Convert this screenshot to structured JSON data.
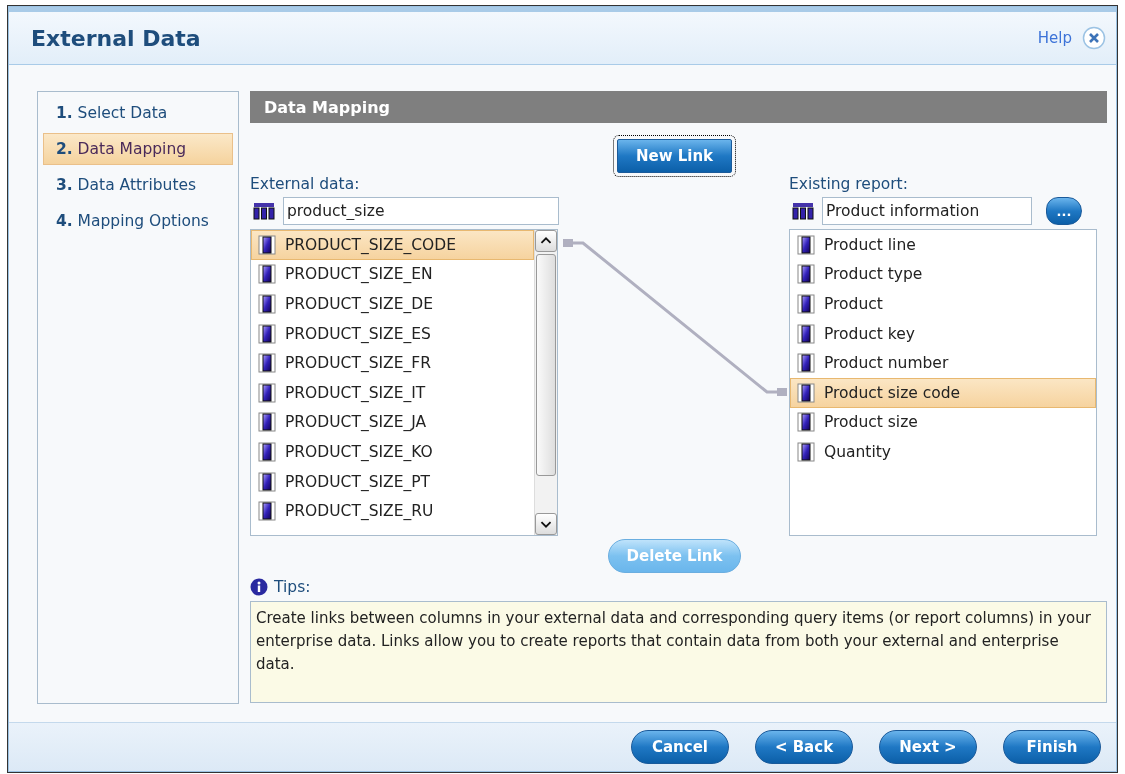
{
  "window": {
    "title": "External Data",
    "help_link": "Help"
  },
  "steps": [
    {
      "label": "**1.** Select Data",
      "selected": false
    },
    {
      "label": "**2.** Data Mapping",
      "selected": true
    },
    {
      "label": "**3.** Data Attributes",
      "selected": false
    },
    {
      "label": "**4.** Mapping Options",
      "selected": false
    }
  ],
  "panel": {
    "title": "Data Mapping",
    "new_link_button": "New Link",
    "delete_link_button": {
      "label": "Delete Link",
      "disabled": true
    },
    "external_data": {
      "label": "External data:",
      "source": "product_size",
      "items": [
        {
          "label": "PRODUCT_SIZE_CODE",
          "selected": true
        },
        {
          "label": "PRODUCT_SIZE_EN",
          "selected": false
        },
        {
          "label": "PRODUCT_SIZE_DE",
          "selected": false
        },
        {
          "label": "PRODUCT_SIZE_ES",
          "selected": false
        },
        {
          "label": "PRODUCT_SIZE_FR",
          "selected": false
        },
        {
          "label": "PRODUCT_SIZE_IT",
          "selected": false
        },
        {
          "label": "PRODUCT_SIZE_JA",
          "selected": false
        },
        {
          "label": "PRODUCT_SIZE_KO",
          "selected": false
        },
        {
          "label": "PRODUCT_SIZE_PT",
          "selected": false
        },
        {
          "label": "PRODUCT_SIZE_RU",
          "selected": false
        }
      ]
    },
    "existing_report": {
      "label": "Existing report:",
      "source": "Product information",
      "browse_button": "...",
      "items": [
        {
          "label": "Product line",
          "selected": false
        },
        {
          "label": "Product type",
          "selected": false
        },
        {
          "label": "Product",
          "selected": false
        },
        {
          "label": "Product key",
          "selected": false
        },
        {
          "label": "Product number",
          "selected": false
        },
        {
          "label": "Product size code",
          "selected": true
        },
        {
          "label": "Product size",
          "selected": false
        },
        {
          "label": "Quantity",
          "selected": false
        }
      ]
    },
    "tips": {
      "label": "Tips:",
      "text": "Create links between columns in your external data and corresponding query items (or report columns) in your enterprise data. Links allow you to create reports that contain data from both your external and enterprise data."
    }
  },
  "buttons": [
    {
      "label": "Cancel"
    },
    {
      "label": "< Back"
    },
    {
      "label": "Next >"
    },
    {
      "label": "Finish"
    }
  ]
}
